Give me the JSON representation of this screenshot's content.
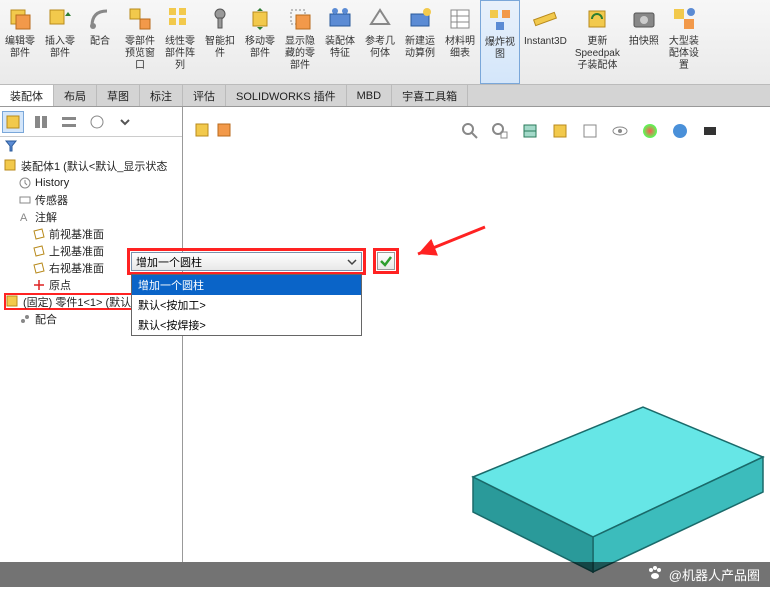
{
  "ribbon": {
    "items": [
      {
        "label": "编辑零\n部件",
        "name": "edit-part"
      },
      {
        "label": "插入零\n部件",
        "name": "insert-part"
      },
      {
        "label": "配合",
        "name": "mate"
      },
      {
        "label": "零部件\n预览窗\n口",
        "name": "component-preview"
      },
      {
        "label": "线性零\n部件阵\n列",
        "name": "linear-pattern"
      },
      {
        "label": "智能扣\n件",
        "name": "smart-fastener"
      },
      {
        "label": "移动零\n部件",
        "name": "move-part"
      },
      {
        "label": "显示隐\n藏的零\n部件",
        "name": "show-hidden"
      },
      {
        "label": "装配体\n特征",
        "name": "assembly-feature"
      },
      {
        "label": "参考几\n何体",
        "name": "reference-geom"
      },
      {
        "label": "新建运\n动算例",
        "name": "new-motion"
      },
      {
        "label": "材料明\n细表",
        "name": "bom"
      },
      {
        "label": "爆炸视\n图",
        "name": "explode-view",
        "selected": true
      },
      {
        "label": "Instant3D",
        "name": "instant3d"
      },
      {
        "label": "更新\nSpeedpak\n子装配体",
        "name": "update-speedpak"
      },
      {
        "label": "拍快照",
        "name": "snapshot"
      },
      {
        "label": "大型装\n配体设\n置",
        "name": "large-assembly"
      }
    ]
  },
  "tabs": {
    "items": [
      {
        "label": "装配体",
        "active": true
      },
      {
        "label": "布局"
      },
      {
        "label": "草图"
      },
      {
        "label": "标注"
      },
      {
        "label": "评估"
      },
      {
        "label": "SOLIDWORKS 插件"
      },
      {
        "label": "MBD"
      },
      {
        "label": "宇喜工具箱"
      }
    ]
  },
  "tree": {
    "root": "装配体1 (默认<默认_显示状态",
    "nodes": [
      {
        "label": "History",
        "icon": "history"
      },
      {
        "label": "传感器",
        "icon": "sensor"
      },
      {
        "label": "注解",
        "icon": "annotation"
      },
      {
        "label": "前视基准面",
        "icon": "plane"
      },
      {
        "label": "上视基准面",
        "icon": "plane"
      },
      {
        "label": "右视基准面",
        "icon": "plane"
      },
      {
        "label": "原点",
        "icon": "origin"
      }
    ],
    "highlighted": "(固定) 零件1<1> (默认<按",
    "after": "配合"
  },
  "combo": {
    "value": "增加一个圆柱",
    "options": [
      {
        "label": "增加一个圆柱",
        "selected": true
      },
      {
        "label": "默认<按加工>"
      },
      {
        "label": "默认<按焊接>"
      }
    ]
  },
  "watermark": "@机器人产品圈"
}
